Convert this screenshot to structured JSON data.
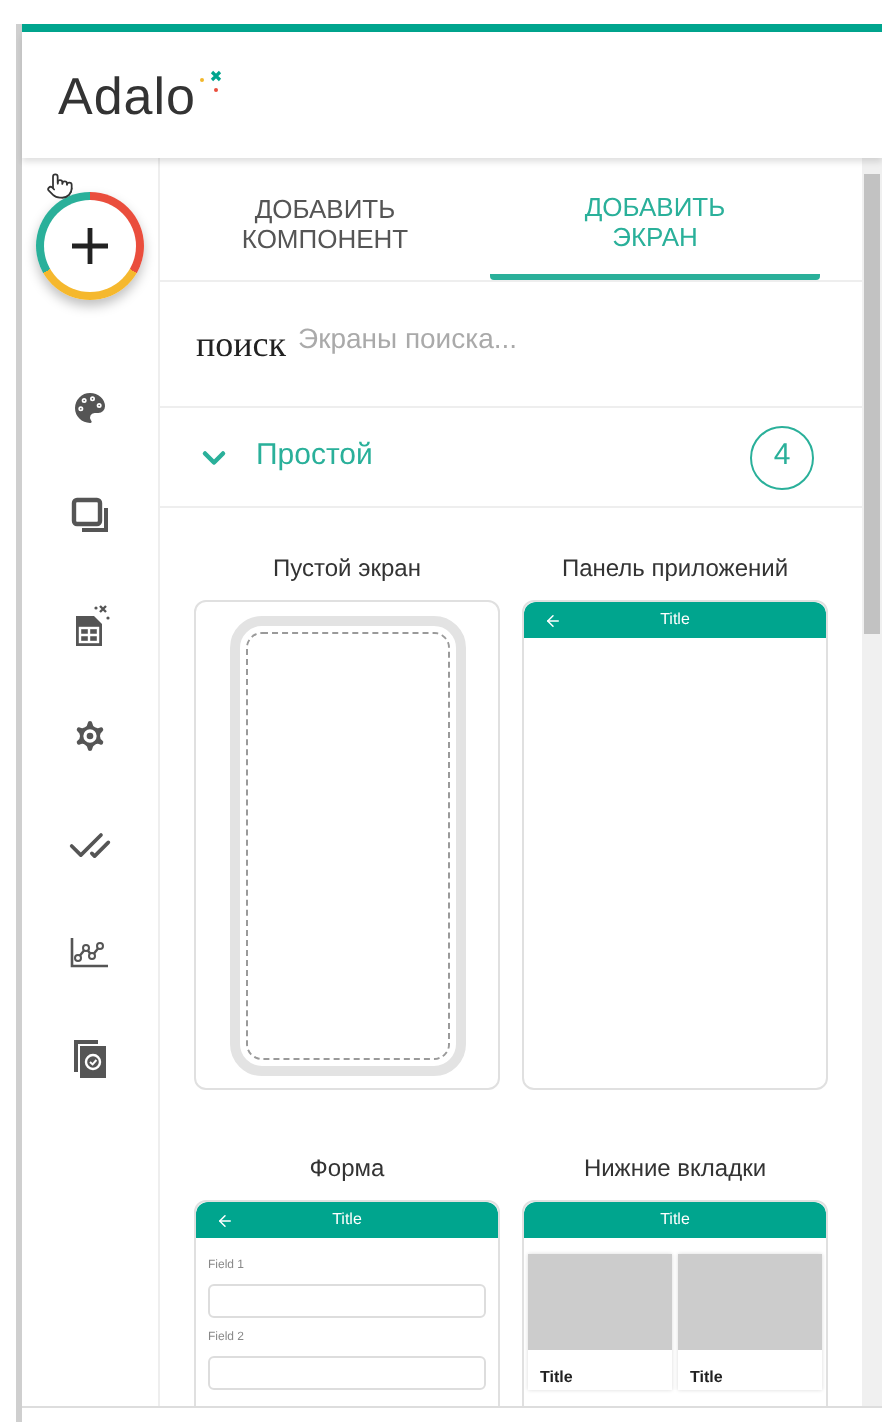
{
  "logo": "Adalo",
  "tabs": [
    {
      "label": "ДОБАВИТЬ КОМПОНЕНТ",
      "selected": false
    },
    {
      "label": "ДОБАВИТЬ ЭКРАН",
      "selected": true
    }
  ],
  "search": {
    "label": "поиск",
    "placeholder": "Экраны поиска..."
  },
  "section": {
    "title": "Простой",
    "count": "4",
    "expanded": true
  },
  "templates": [
    {
      "name": "Пустой экран",
      "kind": "blank"
    },
    {
      "name": "Панель приложений",
      "kind": "appbar",
      "bar_title": "Title"
    },
    {
      "name": "Форма",
      "kind": "form",
      "bar_title": "Title",
      "fields": [
        "Field 1",
        "Field 2"
      ]
    },
    {
      "name": "Нижние вкладки",
      "kind": "tabs",
      "bar_title": "Title",
      "items": [
        "Title",
        "Title"
      ]
    }
  ]
}
